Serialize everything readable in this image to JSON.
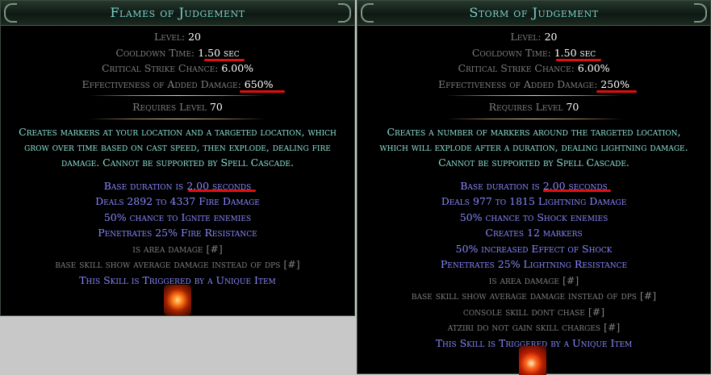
{
  "tooltips": [
    {
      "name": "Flames of Judgement",
      "level_label": "Level:",
      "level": "20",
      "cooldown_label": "Cooldown Time:",
      "cooldown": "1.50 sec",
      "crit_label": "Critical Strike Chance:",
      "crit": "6.00%",
      "eff_label": "Effectiveness of Added Damage:",
      "eff": "650%",
      "req_label": "Requires Level",
      "req": "70",
      "desc": [
        "Creates markers at your location and a targeted location, which",
        "grow over time based on cast speed, then explode, dealing fire",
        "damage. Cannot be supported by Spell Cascade."
      ],
      "mods": [
        {
          "pre": "Base duration is ",
          "val": "2.00",
          "post": " seconds"
        },
        {
          "pre": "Deals ",
          "val": "2892",
          "mid": " to ",
          "val2": "4337",
          "post": " Fire Damage"
        },
        {
          "text": "50% chance to Ignite enemies"
        },
        {
          "text": "Penetrates 25% Fire Resistance"
        },
        {
          "text": "is area damage [#]",
          "gray": true
        },
        {
          "text": "base skill show average damage instead of dps [#]",
          "gray": true
        },
        {
          "text": "This Skill is Triggered by a Unique Item"
        }
      ],
      "icon": "fire-ring-icon"
    },
    {
      "name": "Storm of Judgement",
      "level_label": "Level:",
      "level": "20",
      "cooldown_label": "Cooldown Time:",
      "cooldown": "1.50 sec",
      "crit_label": "Critical Strike Chance:",
      "crit": "6.00%",
      "eff_label": "Effectiveness of Added Damage:",
      "eff": "250%",
      "req_label": "Requires Level",
      "req": "70",
      "desc": [
        "Creates a number of markers around the targeted location,",
        "which will explode after a duration, dealing lightning damage.",
        "Cannot be supported by Spell Cascade."
      ],
      "mods": [
        {
          "pre": "Base duration is ",
          "val": "2.00",
          "post": " seconds"
        },
        {
          "pre": "Deals ",
          "val": "977",
          "mid": " to ",
          "val2": "1815",
          "post": " Lightning Damage"
        },
        {
          "text": "50% chance to Shock enemies"
        },
        {
          "text": "Creates 12 markers"
        },
        {
          "text": "50% increased Effect of Shock"
        },
        {
          "text": "Penetrates 25% Lightning Resistance"
        },
        {
          "text": "is area damage [#]",
          "gray": true
        },
        {
          "text": "base skill show average damage instead of dps [#]",
          "gray": true
        },
        {
          "text": "console skill dont chase [#]",
          "gray": true
        },
        {
          "text": "atziri do not gain skill charges [#]",
          "gray": true
        },
        {
          "text": "This Skill is Triggered by a Unique Item"
        }
      ],
      "icon": "lightning-storm-icon"
    }
  ],
  "colors": {
    "title": "#7bd3cf",
    "label": "#7f7f7f",
    "value": "#ffffff",
    "desc": "#8ae2d4",
    "mod": "#8888ff",
    "highlight": "#e01010"
  }
}
